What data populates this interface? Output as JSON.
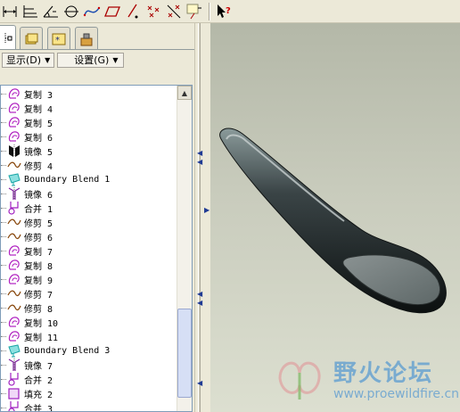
{
  "toolbar": {
    "icons": [
      "dim-horizontal-icon",
      "dim-baseline-icon",
      "dim-angle-icon",
      "circle-center-icon",
      "spline-curve-icon",
      "plane-icon",
      "line-point-icon",
      "points-icon",
      "axis-points-icon",
      "sketch-bracket-icon",
      "help-cursor-icon"
    ],
    "help_label": "?"
  },
  "tabs": [
    "model-tree-tab",
    "folder-tab",
    "layer-tab",
    "tools-tab"
  ],
  "menus": {
    "display": "显示(D)",
    "settings": "设置(G)"
  },
  "tree": {
    "items": [
      {
        "icon": "copy-icon",
        "label": "复制 3"
      },
      {
        "icon": "copy-icon",
        "label": "复制 4"
      },
      {
        "icon": "copy-icon",
        "label": "复制 5"
      },
      {
        "icon": "copy-icon",
        "label": "复制 6"
      },
      {
        "icon": "mirror-icon",
        "label": "镜像 5"
      },
      {
        "icon": "trim-icon",
        "label": "修剪 4"
      },
      {
        "icon": "boundary-blend-icon",
        "label": "Boundary Blend 1"
      },
      {
        "icon": "mirror-outline-icon",
        "label": "镜像 6"
      },
      {
        "icon": "merge-icon",
        "label": "合并 1"
      },
      {
        "icon": "trim-icon",
        "label": "修剪 5"
      },
      {
        "icon": "trim-icon",
        "label": "修剪 6"
      },
      {
        "icon": "copy-icon",
        "label": "复制 7"
      },
      {
        "icon": "copy-icon",
        "label": "复制 8"
      },
      {
        "icon": "copy-icon",
        "label": "复制 9"
      },
      {
        "icon": "trim-icon",
        "label": "修剪 7"
      },
      {
        "icon": "trim-icon",
        "label": "修剪 8"
      },
      {
        "icon": "copy-icon",
        "label": "复制 10"
      },
      {
        "icon": "copy-icon",
        "label": "复制 11"
      },
      {
        "icon": "boundary-blend-icon",
        "label": "Boundary Blend 3"
      },
      {
        "icon": "mirror-outline-icon",
        "label": "镜像 7"
      },
      {
        "icon": "merge-icon",
        "label": "合并 2"
      },
      {
        "icon": "fill-icon",
        "label": "填充 2"
      },
      {
        "icon": "merge-icon",
        "label": "合并 3"
      }
    ]
  },
  "watermark": {
    "title": "野火论坛",
    "url": "www.proewildfire.cn"
  },
  "colors": {
    "copy": "#b020c0",
    "trim": "#8a4a10",
    "blend": "#1aa6a6",
    "merge": "#a020c0",
    "watermark": "#5a9bd1"
  }
}
